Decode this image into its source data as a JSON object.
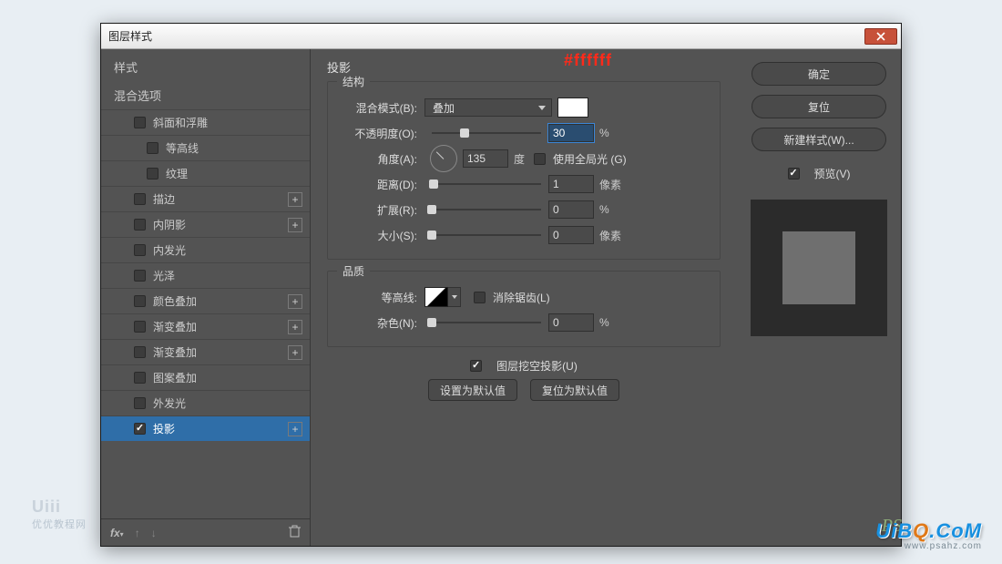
{
  "dialog": {
    "title": "图层样式"
  },
  "annotation": {
    "color_hex": "#ffffff"
  },
  "styles": {
    "header": "样式",
    "blend_options": "混合选项",
    "items": [
      {
        "label": "斜面和浮雕",
        "checked": false,
        "plus": false,
        "indent": 1
      },
      {
        "label": "等高线",
        "checked": false,
        "plus": false,
        "indent": 2
      },
      {
        "label": "纹理",
        "checked": false,
        "plus": false,
        "indent": 2
      },
      {
        "label": "描边",
        "checked": false,
        "plus": true,
        "indent": 1
      },
      {
        "label": "内阴影",
        "checked": false,
        "plus": true,
        "indent": 1
      },
      {
        "label": "内发光",
        "checked": false,
        "plus": false,
        "indent": 1
      },
      {
        "label": "光泽",
        "checked": false,
        "plus": false,
        "indent": 1
      },
      {
        "label": "颜色叠加",
        "checked": false,
        "plus": true,
        "indent": 1
      },
      {
        "label": "渐变叠加",
        "checked": false,
        "plus": true,
        "indent": 1
      },
      {
        "label": "渐变叠加",
        "checked": false,
        "plus": true,
        "indent": 1
      },
      {
        "label": "图案叠加",
        "checked": false,
        "plus": false,
        "indent": 1
      },
      {
        "label": "外发光",
        "checked": false,
        "plus": false,
        "indent": 1
      },
      {
        "label": "投影",
        "checked": true,
        "plus": true,
        "indent": 1,
        "selected": true
      }
    ]
  },
  "panel": {
    "title": "投影",
    "structure": {
      "legend": "结构",
      "blend_mode_label": "混合模式(B):",
      "blend_mode_value": "叠加",
      "opacity_label": "不透明度(O):",
      "opacity_value": "30",
      "opacity_unit": "%",
      "angle_label": "角度(A):",
      "angle_value": "135",
      "angle_unit": "度",
      "global_light_label": "使用全局光 (G)",
      "global_light_checked": false,
      "distance_label": "距离(D):",
      "distance_value": "1",
      "distance_unit": "像素",
      "spread_label": "扩展(R):",
      "spread_value": "0",
      "spread_unit": "%",
      "size_label": "大小(S):",
      "size_value": "0",
      "size_unit": "像素"
    },
    "quality": {
      "legend": "品质",
      "contour_label": "等高线:",
      "antialias_label": "消除锯齿(L)",
      "antialias_checked": false,
      "noise_label": "杂色(N):",
      "noise_value": "0",
      "noise_unit": "%"
    },
    "knockout_label": "图层挖空投影(U)",
    "knockout_checked": true,
    "make_default": "设置为默认值",
    "reset_default": "复位为默认值"
  },
  "buttons": {
    "ok": "确定",
    "cancel": "复位",
    "new_style": "新建样式(W)...",
    "preview_label": "预览(V)",
    "preview_checked": true
  },
  "watermarks": {
    "left_main": "Uiii",
    "left_sub": "优优教程网",
    "logo_pre": "UiB",
    "logo_o": "Q",
    "logo_post": ".CoM",
    "url": "www.psahz.com",
    "ps": "PS"
  }
}
